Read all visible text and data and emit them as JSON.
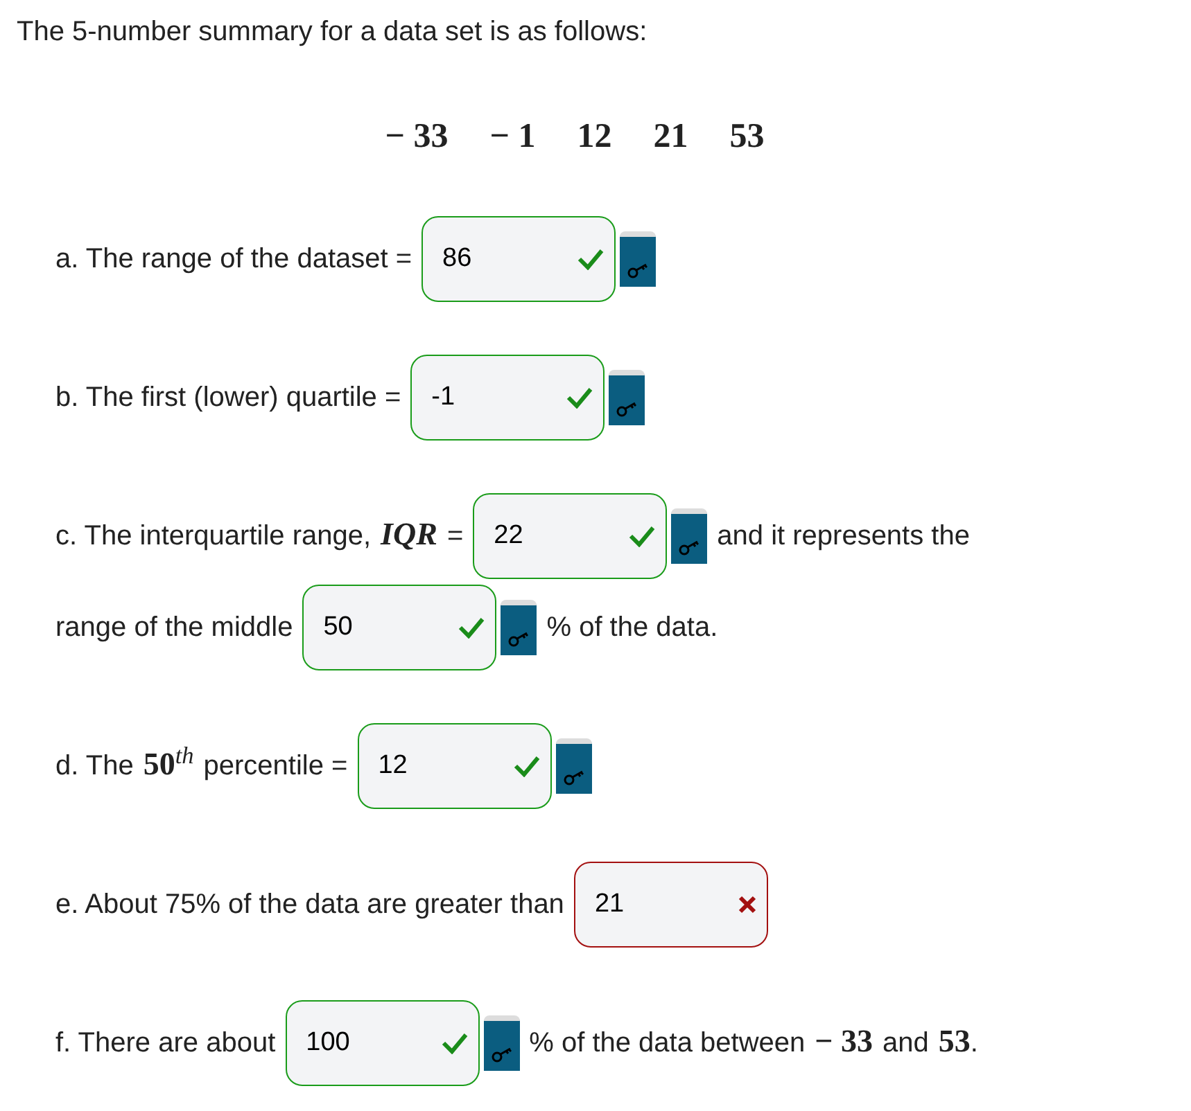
{
  "intro": "The 5-number summary for a data set is as follows:",
  "summary": [
    "− 33",
    "− 1",
    "12",
    "21",
    "53"
  ],
  "questions": [
    {
      "lines": [
        [
          {
            "kind": "text",
            "text": "a. The range of the dataset ="
          },
          {
            "kind": "field",
            "value": "86",
            "correct": true,
            "key": true
          }
        ]
      ]
    },
    {
      "lines": [
        [
          {
            "kind": "text",
            "text": "b. The first (lower) quartile ="
          },
          {
            "kind": "field",
            "value": "-1",
            "correct": true,
            "key": true
          }
        ]
      ]
    },
    {
      "lines": [
        [
          {
            "kind": "text",
            "text": "c. The interquartile range,"
          },
          {
            "kind": "var",
            "text": "IQR"
          },
          {
            "kind": "text",
            "text": "="
          },
          {
            "kind": "field",
            "value": "22",
            "correct": true,
            "key": true
          },
          {
            "kind": "text",
            "text": "and it represents the"
          }
        ],
        [
          {
            "kind": "text",
            "text": "range of the middle"
          },
          {
            "kind": "field",
            "value": "50",
            "correct": true,
            "key": true
          },
          {
            "kind": "text",
            "text": "% of the data."
          }
        ]
      ]
    },
    {
      "lines": [
        [
          {
            "kind": "text",
            "text": "d. The"
          },
          {
            "kind": "math",
            "text": "50$^{th}$"
          },
          {
            "kind": "text",
            "text": "percentile ="
          },
          {
            "kind": "field",
            "value": "12",
            "correct": true,
            "key": true
          }
        ]
      ]
    },
    {
      "lines": [
        [
          {
            "kind": "text",
            "text": "e. About 75% of the data are greater than"
          },
          {
            "kind": "field",
            "value": "21",
            "correct": false,
            "key": false
          }
        ]
      ]
    },
    {
      "lines": [
        [
          {
            "kind": "text",
            "text": "f. There are about"
          },
          {
            "kind": "field",
            "value": "100",
            "correct": true,
            "key": true
          },
          {
            "kind": "text",
            "text": "% of the data between"
          },
          {
            "kind": "math",
            "text": "− 33"
          },
          {
            "kind": "text",
            "text": "and"
          },
          {
            "kind": "math",
            "text": "53"
          },
          {
            "kind": "punct",
            "text": "."
          }
        ]
      ]
    }
  ]
}
